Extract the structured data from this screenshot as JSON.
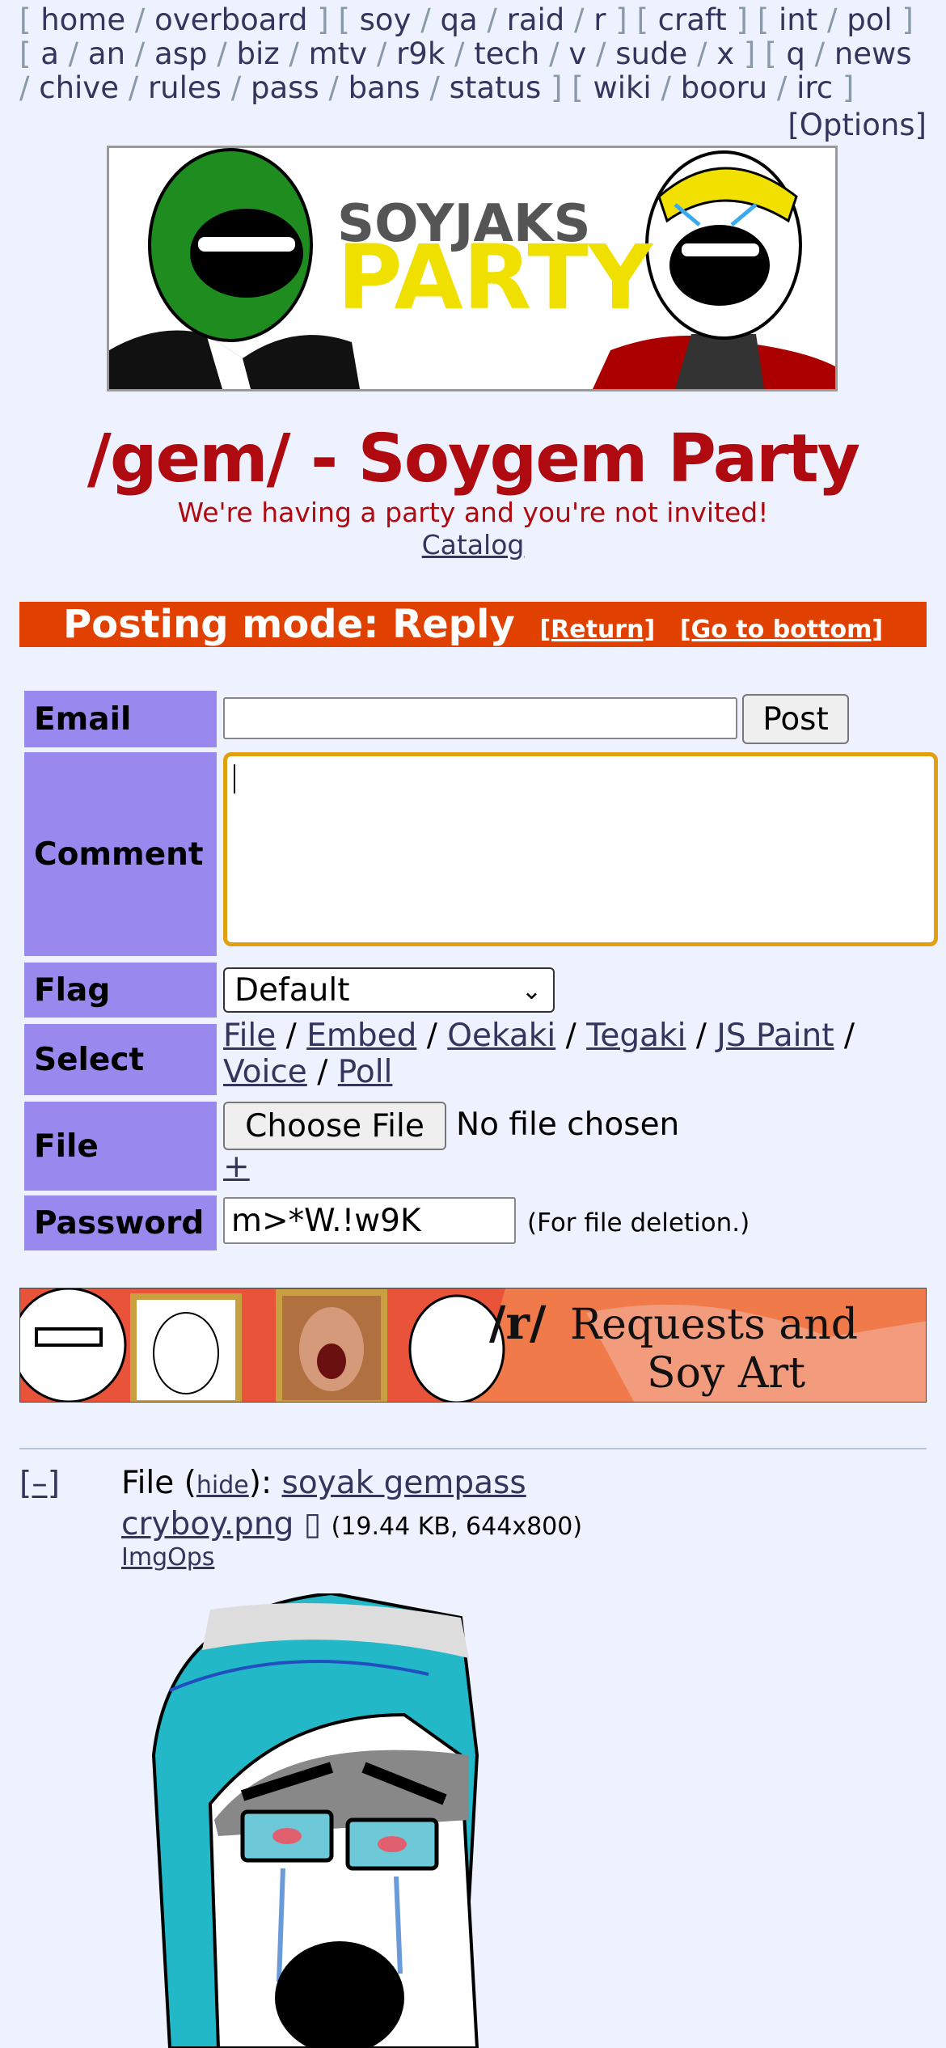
{
  "boardlist": {
    "groups": [
      [
        "home",
        "overboard"
      ],
      [
        "soy",
        "qa",
        "raid",
        "r"
      ],
      [
        "craft"
      ],
      [
        "int",
        "pol"
      ],
      [
        "a",
        "an",
        "asp",
        "biz",
        "mtv",
        "r9k",
        "tech",
        "v",
        "sude",
        "x"
      ],
      [
        "q",
        "news",
        "chive",
        "rules",
        "pass",
        "bans",
        "status"
      ],
      [
        "wiki",
        "booru",
        "irc"
      ]
    ],
    "options": "[Options]"
  },
  "banner": {
    "line1": "SOYJAKS",
    "line2": "PARTY"
  },
  "board": {
    "title": "/gem/ - Soygem Party",
    "subtitle": "We're having a party and you're not invited!",
    "catalog": "Catalog"
  },
  "mode": {
    "text": "Posting mode: Reply",
    "return": "[Return]",
    "bottom": "[Go to bottom]"
  },
  "form": {
    "email_label": "Email",
    "post_button": "Post",
    "comment_label": "Comment",
    "flag_label": "Flag",
    "flag_value": "Default",
    "select_label": "Select",
    "select_links": [
      "File",
      "Embed",
      "Oekaki",
      "Tegaki",
      "JS Paint",
      "Voice",
      "Poll"
    ],
    "file_label": "File",
    "choose_file": "Choose File",
    "no_file": "No file chosen",
    "plus": "+",
    "password_label": "Password",
    "password_value": "m>*W.!w9K",
    "password_note": "(For file deletion.)"
  },
  "ad": {
    "text": "/r/ Requests and Soy Art"
  },
  "post": {
    "collapse": "[–]",
    "file_prefix": "File (",
    "hide": "hide",
    "file_mid": "): ",
    "filename": "soyak gempass cryboy.png",
    "icon": "▯",
    "meta": "(19.44 KB, 644x800)",
    "imgops": "ImgOps"
  },
  "colors": {
    "title": "#af0a0f",
    "modebar": "#e04000",
    "label_bg": "#9988ee",
    "bg": "#eef2ff"
  }
}
